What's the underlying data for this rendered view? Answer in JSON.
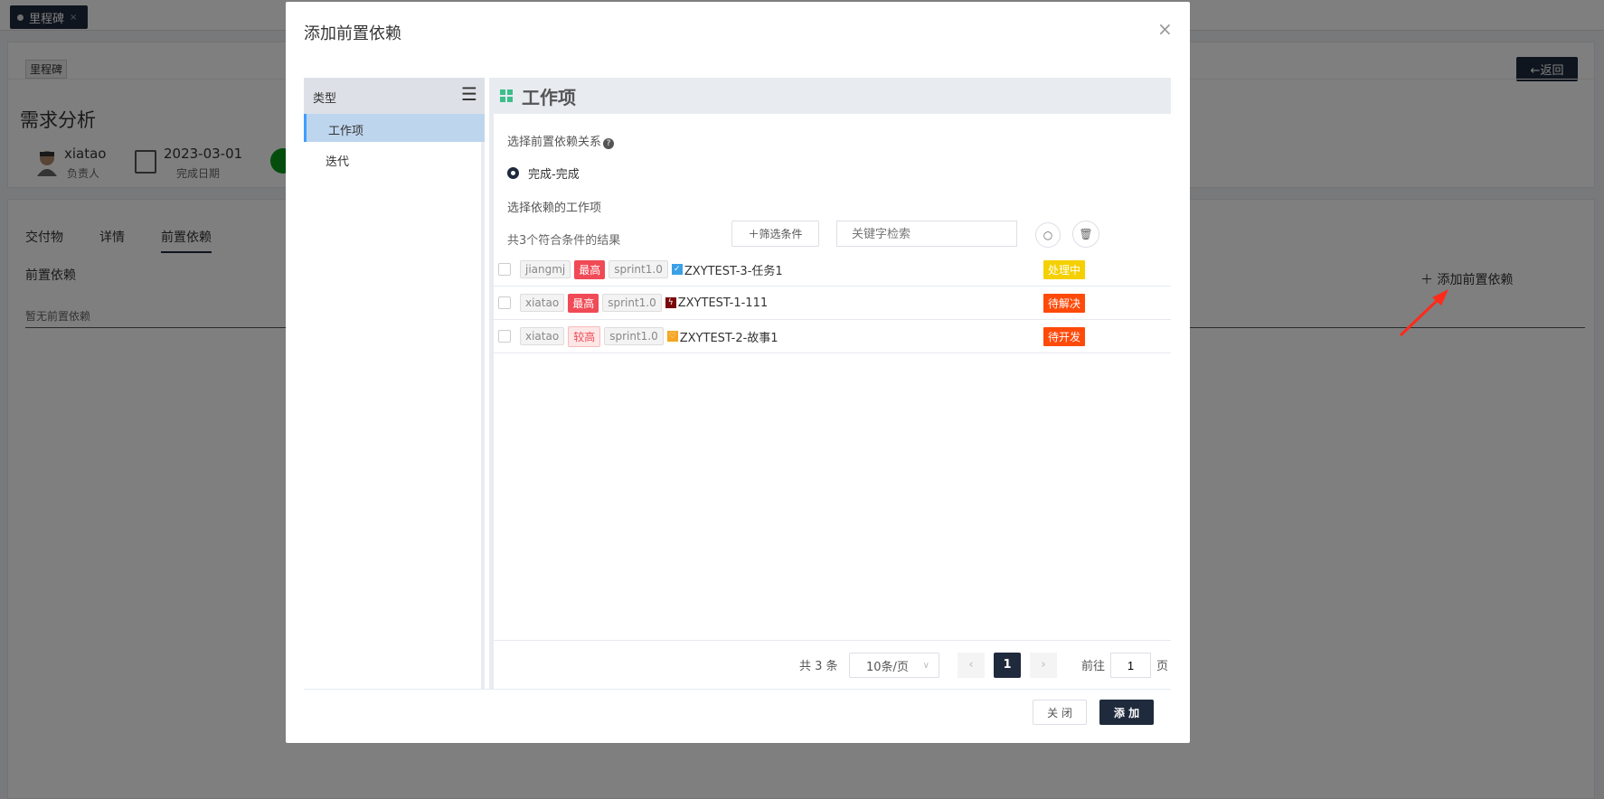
{
  "page_tab": {
    "label": "里程碑",
    "close": "×"
  },
  "milestone": {
    "tag": "里程碑",
    "back_label": "←返回",
    "title": "需求分析",
    "owner": {
      "name": "xiatao",
      "label": "负责人"
    },
    "due": {
      "date": "2023-03-01",
      "label": "完成日期"
    }
  },
  "detail_tabs": [
    {
      "label": "交付物"
    },
    {
      "label": "详情"
    },
    {
      "label": "前置依赖",
      "active": true
    }
  ],
  "deps": {
    "section_title": "前置依赖",
    "empty_text": "暂无前置依赖",
    "add_label": "添加前置依赖"
  },
  "modal": {
    "title": "添加前置依赖",
    "close": "×",
    "type_header": "类型",
    "types": [
      {
        "label": "工作项",
        "selected": true
      },
      {
        "label": "迭代"
      }
    ],
    "panel_title": "工作项",
    "relation_label": "选择前置依赖关系",
    "relation_option": "完成-完成",
    "pick_label": "选择依赖的工作项",
    "result_count": "共3个符合条件的结果",
    "filter_label": "筛选条件",
    "search_placeholder": "关键字检索",
    "items": [
      {
        "owner": "jiangmj",
        "priority": "最高",
        "sprint": "sprint1.0",
        "type": "task",
        "type_color": "#3aa0e8",
        "title": "ZXYTEST-3-任务1",
        "status": "处理中",
        "status_color": "#f5d000"
      },
      {
        "owner": "xiatao",
        "priority": "最高",
        "sprint": "sprint1.0",
        "type": "bug",
        "type_color": "#7a0a0a",
        "title": "ZXYTEST-1-111",
        "status": "待解决",
        "status_color": "#ff4a0a"
      },
      {
        "owner": "xiatao",
        "priority": "较高",
        "sprint": "sprint1.0",
        "type": "story",
        "type_color": "#f5a623",
        "title": "ZXYTEST-2-故事1",
        "status": "待开发",
        "status_color": "#ff4a0a"
      }
    ],
    "pagination": {
      "total": "共 3 条",
      "page_size": "10条/页",
      "current": "1",
      "goto_label": "前往",
      "goto_value": "1",
      "page_unit": "页"
    },
    "cancel_label": "关 闭",
    "confirm_label": "添 加"
  }
}
